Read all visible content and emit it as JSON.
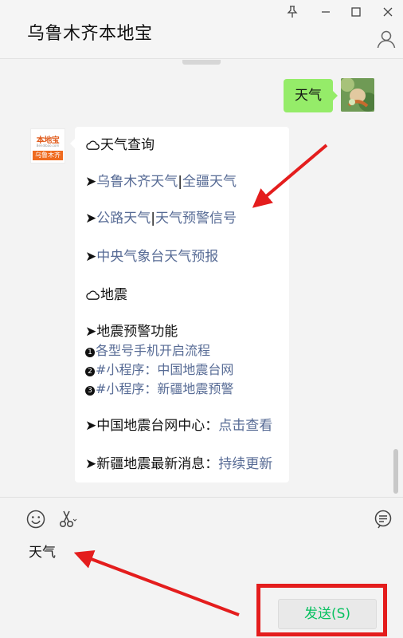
{
  "window": {
    "title": "乌鲁木齐本地宝"
  },
  "chat": {
    "my_message": "天气",
    "bot_avatar": {
      "logo_text": "本地宝",
      "logo_url": "Bendibao.com",
      "logo_city": "乌鲁木齐"
    },
    "bot_message": {
      "weather_header": "天气查询",
      "weather_link_1": "乌鲁木齐天气",
      "weather_link_2": "全疆天气",
      "road_link_1": "公路天气",
      "road_link_2": "天气预警信号",
      "cma_link": "中央气象台天气预报",
      "quake_header": "地震",
      "quake_warning": "➤地震预警功能",
      "quake_item_1": "各型号手机开启流程",
      "quake_item_2": "#小程序：中国地震台网",
      "quake_item_3": "#小程序：新疆地震预警",
      "center_label": "➤中国地震台网中心：",
      "center_link": "点击查看",
      "news_label": "➤新疆地震最新消息：",
      "news_link": "持续更新",
      "arrow_glyph": "➤",
      "bar": "|"
    }
  },
  "input": {
    "text": "天气",
    "send_label": "发送(S)"
  },
  "colors": {
    "my_bubble": "#95ec69",
    "link": "#576b95",
    "send_text": "#07c160",
    "annotation": "#e41d1d"
  }
}
